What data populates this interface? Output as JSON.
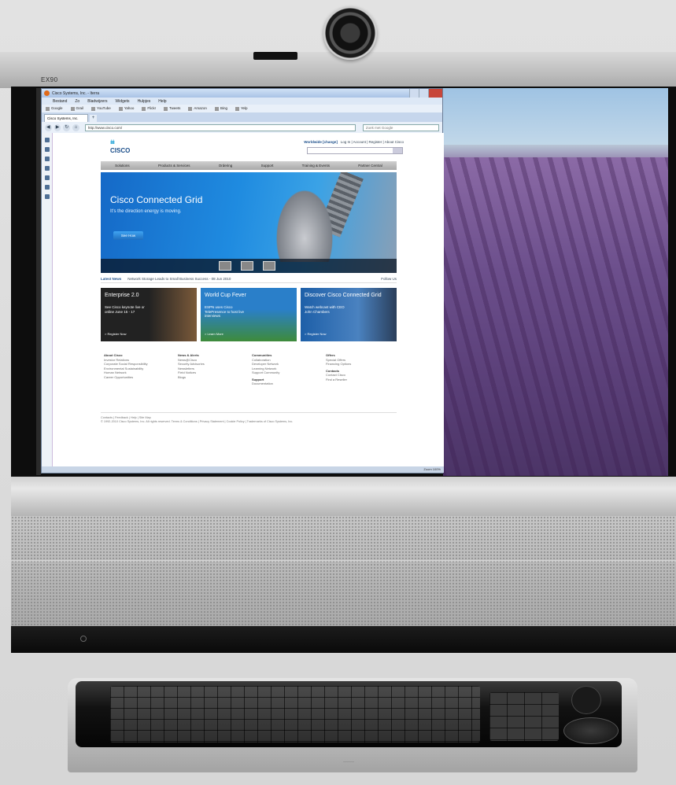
{
  "device": {
    "model_label": "EX90"
  },
  "browser": {
    "window_title": "Cisco Systems, Inc. - Iterra",
    "menu": [
      "Bestand",
      "Zo",
      "Bladwijzers",
      "Widgets",
      "Hulpjes",
      "Help"
    ],
    "bookmarks": [
      "Google",
      "Grail",
      "YouTube",
      "Yahoo",
      "Flickr",
      "Tweets",
      "Amazon",
      "Bing",
      "Yelp"
    ],
    "tabs": [
      {
        "label": "Cisco Systems, Inc."
      }
    ],
    "new_tab": "+",
    "url": "http://www.cisco.com/",
    "search_placeholder": "Zoek met Google",
    "status_left": "",
    "status_right": "Zoom 100%"
  },
  "page": {
    "logo_bars": "ılıılı",
    "logo_text": "CISCO",
    "toplinks": {
      "worldwide": "Worldwide [change]",
      "links": "Log In | Account | Register | About Cisco"
    },
    "nav": [
      "Solutions",
      "Products & Services",
      "Ordering",
      "Support",
      "Training & Events",
      "Partner Central"
    ],
    "hero": {
      "title": "Cisco Connected Grid",
      "subtitle": "It's the direction energy is moving.",
      "button": "See How"
    },
    "news": {
      "label": "Latest News",
      "headline": "Network Storage Leads to Small Business Success - 08 Jun 2010",
      "follow": "Follow Us"
    },
    "promos": [
      {
        "title": "Enterprise 2.0",
        "desc": "See Cisco keynote live or online June 15 - 17",
        "link": "> Register Now"
      },
      {
        "title": "World Cup Fever",
        "desc": "ESPN uses Cisco TelePresence to host live interviews",
        "link": "> Learn More"
      },
      {
        "title": "Discover Cisco Connected Grid",
        "desc": "Watch webcast with CEO John Chambers",
        "link": "> Register Now"
      }
    ],
    "footer_cols": [
      {
        "head": "About Cisco",
        "items": [
          "Investor Relations",
          "Corporate Social Responsibility",
          "Environmental Sustainability",
          "Human Network",
          "Career Opportunities"
        ]
      },
      {
        "head": "News & Alerts",
        "items": [
          "News@Cisco",
          "Security Advisories",
          "Newsletters",
          "Field Notices",
          "Blogs"
        ]
      },
      {
        "head": "Communities",
        "items": [
          "Collaboration",
          "Developer Network",
          "Learning Network",
          "Support Community"
        ]
      },
      {
        "head": "Offers",
        "items": [
          "Special Offers",
          "Financing Options",
          "Contacts",
          "Contact Cisco",
          "Find a Reseller"
        ]
      }
    ],
    "support_head": "Support",
    "support_item": "Documentation",
    "copyright_links": "Contacts | Feedback | Help | Site Map",
    "copyright": "© 1992-2010 Cisco Systems, Inc. All rights reserved.  Terms & Conditions | Privacy Statement | Cookie Policy | Trademarks of Cisco Systems, Inc."
  }
}
